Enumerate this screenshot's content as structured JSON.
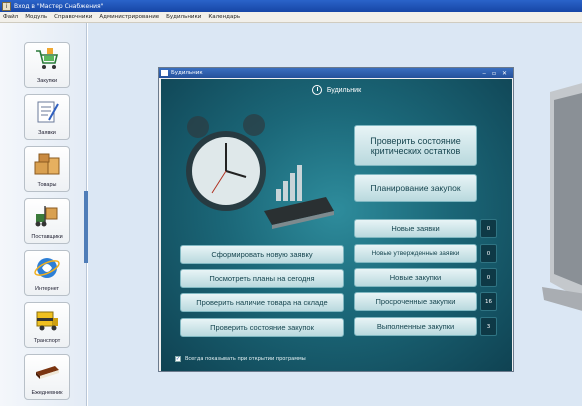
{
  "window": {
    "title": "Вход в \"Мастер Снабжения\""
  },
  "menu": [
    "Файл",
    "Модуль",
    "Справочники",
    "Администрирование",
    "Будильники",
    "Календарь"
  ],
  "sidebar": {
    "items": [
      {
        "label": "Закупки",
        "icon": "cart-icon"
      },
      {
        "label": "Заявки",
        "icon": "notepad-icon"
      },
      {
        "label": "Товары",
        "icon": "boxes-icon"
      },
      {
        "label": "Поставщики",
        "icon": "forklift-icon"
      },
      {
        "label": "Интернет",
        "icon": "internet-icon"
      },
      {
        "label": "Транспорт",
        "icon": "truck-icon"
      },
      {
        "label": "Ежедневник",
        "icon": "diary-icon"
      }
    ]
  },
  "dialog": {
    "window_title": "Будильник",
    "header": "Будильник",
    "left_buttons": [
      "Сформировать новую заявку",
      "Посмотреть планы на сегодня",
      "Проверить наличие товара на складе",
      "Проверить состояние закупок"
    ],
    "check_critical": "Проверить состояние критических остатков",
    "plan_purchases": "Планирование закупок",
    "counters": [
      {
        "label": "Новые заявки",
        "count": "0"
      },
      {
        "label": "Новые утвержденные заявки",
        "count": "0"
      },
      {
        "label": "Новые закупки",
        "count": "0"
      },
      {
        "label": "Просроченные закупки",
        "count": "16"
      },
      {
        "label": "Выполненные закупки",
        "count": "3"
      }
    ],
    "always_show_label": "Всегда показывать при открытии программы",
    "always_show_checked": true
  },
  "colors": {
    "titlebar": "#1f55b5",
    "dialog_bg": "#1b6778",
    "button_text": "#16454f"
  }
}
